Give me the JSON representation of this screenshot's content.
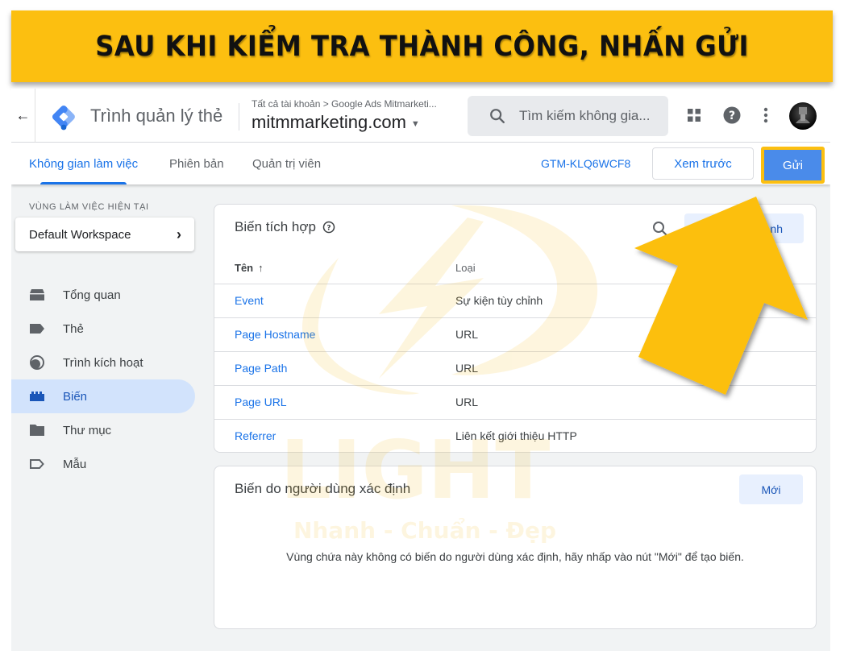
{
  "banner": {
    "text": "SAU KHI KIỂM TRA THÀNH CÔNG, NHẤN GỬI"
  },
  "header": {
    "app_name": "Trình quản lý thẻ",
    "breadcrumb": "Tất cả tài khoản > Google Ads Mitmarketi...",
    "container_name": "mitmmarketing.com",
    "search_placeholder": "Tìm kiếm không gia...",
    "icons": [
      "back-arrow-icon",
      "tag-manager-logo",
      "search-icon",
      "apps-grid-icon",
      "help-icon",
      "more-vert-icon",
      "avatar"
    ]
  },
  "tabs": [
    {
      "label": "Không gian làm việc",
      "active": true
    },
    {
      "label": "Phiên bản",
      "active": false
    },
    {
      "label": "Quản trị viên",
      "active": false
    }
  ],
  "toolbar": {
    "container_id": "GTM-KLQ6WCF8",
    "preview_label": "Xem trước",
    "submit_label": "Gửi"
  },
  "sidebar": {
    "workspace_label": "VÙNG LÀM VIỆC HIỆN TẠI",
    "workspace_name": "Default Workspace",
    "items": [
      {
        "label": "Tổng quan",
        "icon": "overview-icon",
        "active": false
      },
      {
        "label": "Thẻ",
        "icon": "tag-icon",
        "active": false
      },
      {
        "label": "Trình kích hoạt",
        "icon": "trigger-icon",
        "active": false
      },
      {
        "label": "Biến",
        "icon": "variable-icon",
        "active": true
      },
      {
        "label": "Thư mục",
        "icon": "folder-icon",
        "active": false
      },
      {
        "label": "Mẫu",
        "icon": "template-icon",
        "active": false
      }
    ]
  },
  "builtin": {
    "title": "Biến tích hợp",
    "configure_label_visible": "nh",
    "columns": {
      "name": "Tên",
      "type": "Loại"
    },
    "rows": [
      {
        "name": "Event",
        "type": "Sự kiện tùy chỉnh"
      },
      {
        "name": "Page Hostname",
        "type": "URL"
      },
      {
        "name": "Page Path",
        "type": "URL"
      },
      {
        "name": "Page URL",
        "type": "URL"
      },
      {
        "name": "Referrer",
        "type": "Liên kết giới thiệu HTTP"
      }
    ]
  },
  "user_defined": {
    "title": "Biến do người dùng xác định",
    "new_label": "Mới",
    "empty_message": "Vùng chứa này không có biến do người dùng xác định, hãy nhấp vào nút \"Mới\" để tạo biến."
  },
  "watermark": {
    "brand": "LIGHT",
    "slogan": "Nhanh - Chuẩn - Đẹp"
  },
  "colors": {
    "banner": "#fcbf10",
    "accent": "#1a73e8",
    "submit": "#4a8bea",
    "active_nav": "#d2e3fc",
    "arrow": "#fcbf10"
  }
}
